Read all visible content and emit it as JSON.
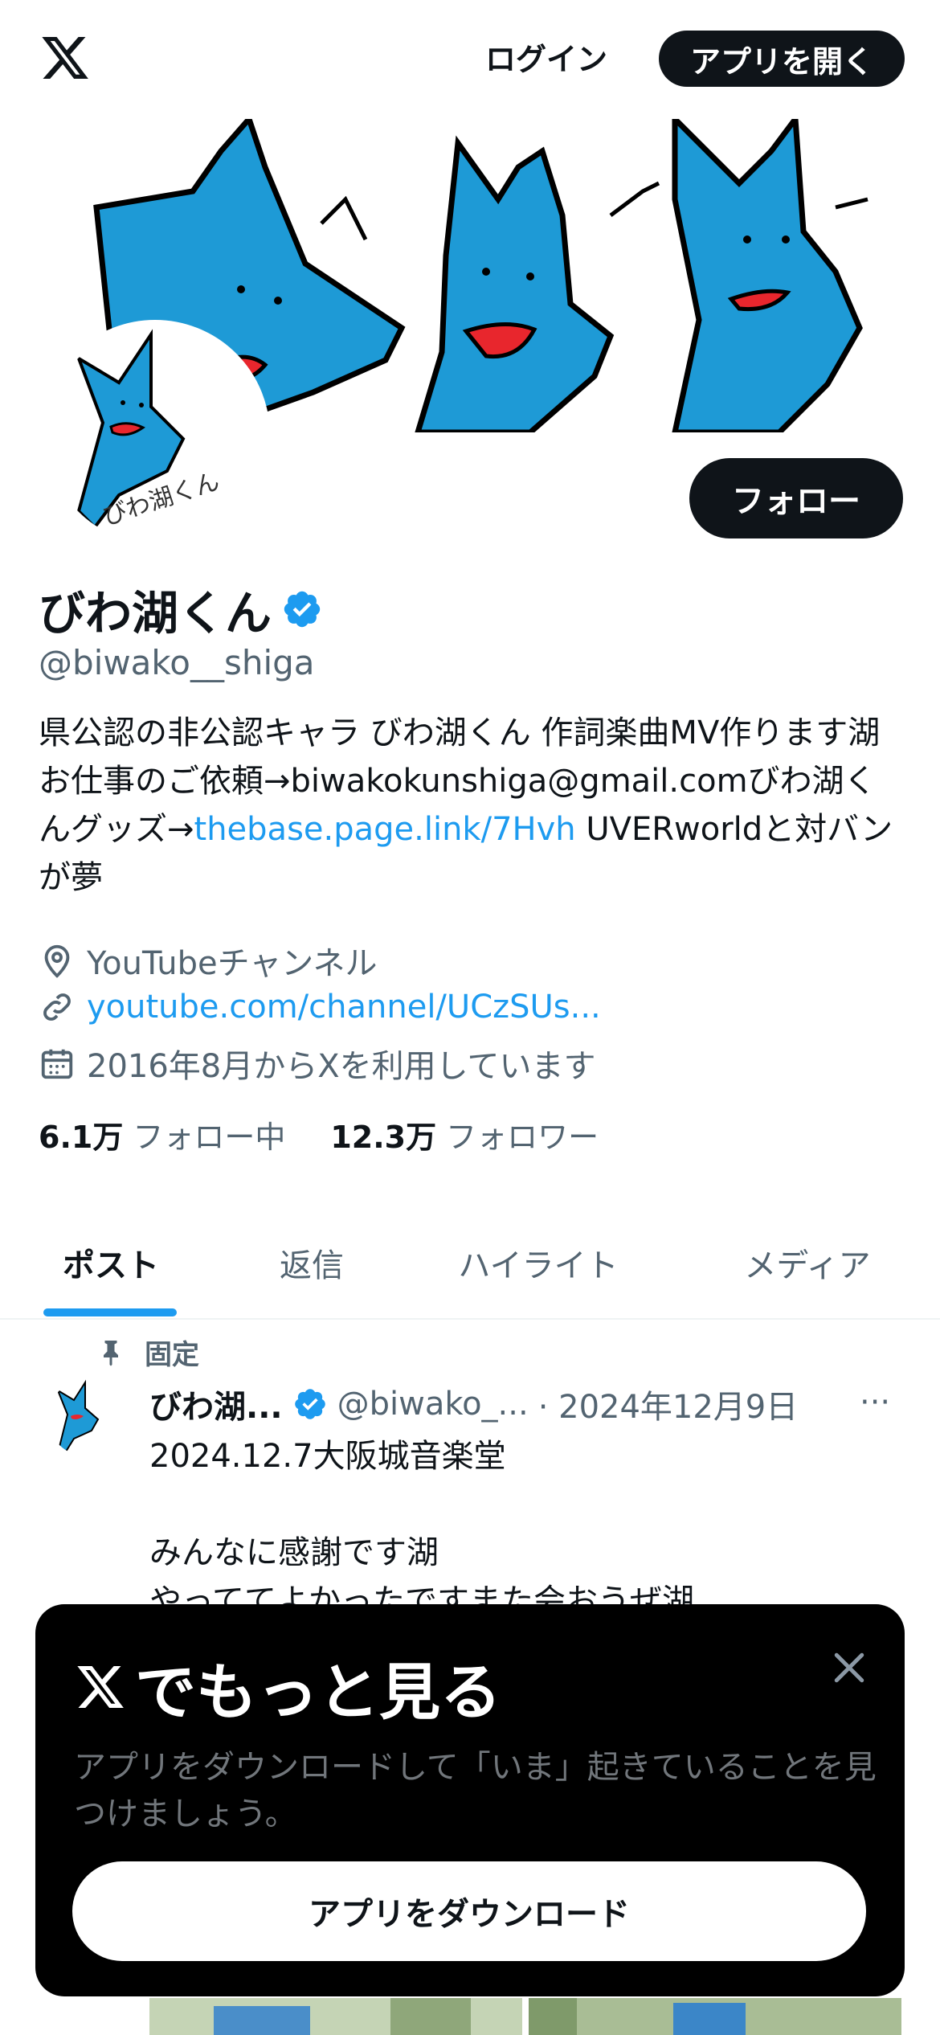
{
  "topbar": {
    "login_label": "ログイン",
    "open_app_label": "アプリを開く"
  },
  "profile": {
    "follow_label": "フォロー",
    "display_name": "びわ湖くん",
    "handle": "@biwako__shiga",
    "bio_part1": "県公認の非公認キャラ びわ湖くん 作詞楽曲MV作ります湖 お仕事のご依頼→biwakokunshiga@gmail.comびわ湖くんグッズ→",
    "bio_link": "thebase.page.link/7Hvh",
    "bio_part2": " UVERworldと対バンが夢",
    "location": "YouTubeチャンネル",
    "website": "youtube.com/channel/UCzSUs...",
    "joined": "2016年8月からXを利用しています",
    "following_count": "6.1万",
    "following_label": "フォロー中",
    "followers_count": "12.3万",
    "followers_label": "フォロワー"
  },
  "tabs": [
    {
      "label": "ポスト"
    },
    {
      "label": "返信"
    },
    {
      "label": "ハイライト"
    },
    {
      "label": "メディア"
    }
  ],
  "post": {
    "pinned_label": "固定",
    "author": "びわ湖...",
    "handle": "@biwako_...",
    "date": "· 2024年12月9日",
    "more": "···",
    "line1": "2024.12.7大阪城音楽堂",
    "line2": "",
    "line3": "みんなに感謝です湖",
    "line4": "やっててよかったですまた会おうぜ湖"
  },
  "modal": {
    "title": "でもっと見る",
    "description": "アプリをダウンロードして「いま」起きていることを見つけましょう。",
    "download_label": "アプリをダウンロード"
  },
  "colors": {
    "accent": "#1d9bf0",
    "text": "#0f1419",
    "muted": "#536471",
    "character_blue": "#1e9ad6",
    "mouth_red": "#e8262d"
  }
}
